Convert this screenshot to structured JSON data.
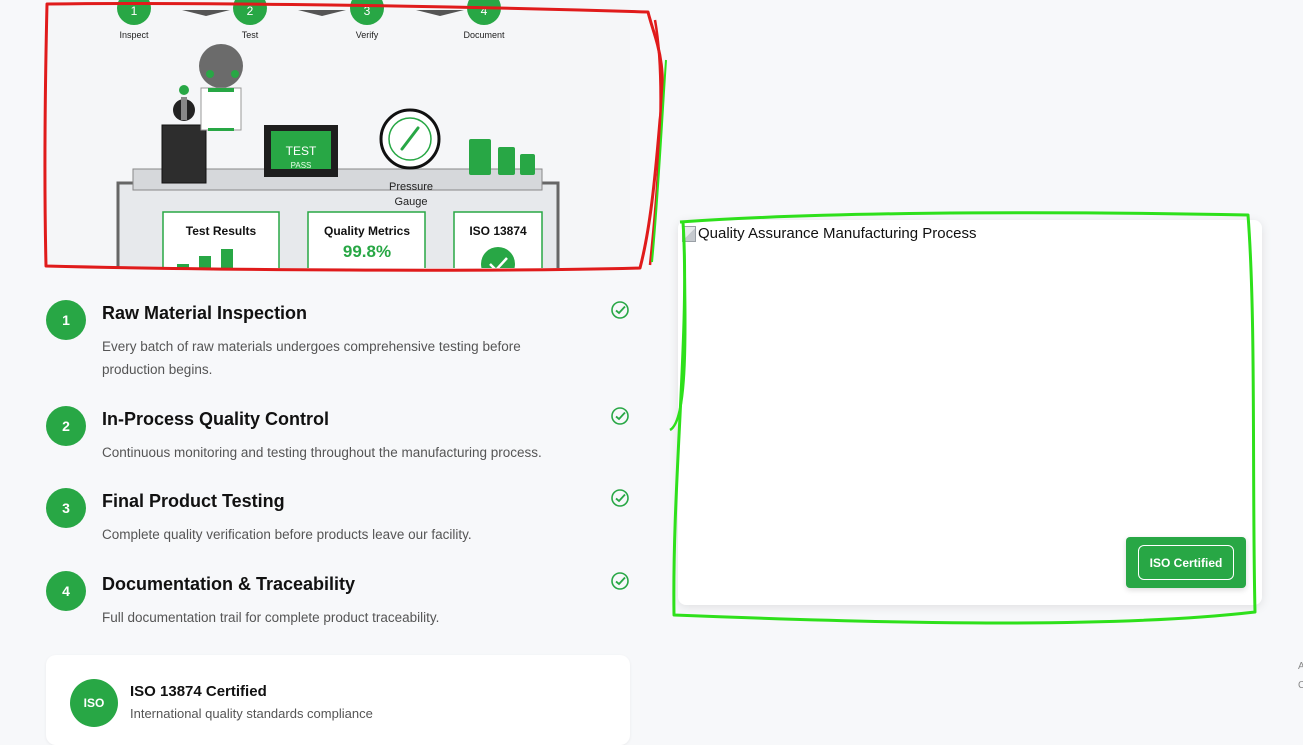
{
  "illustration": {
    "process_steps": [
      {
        "number": "1",
        "label": "Inspect"
      },
      {
        "number": "2",
        "label": "Test"
      },
      {
        "number": "3",
        "label": "Verify"
      },
      {
        "number": "4",
        "label": "Document"
      }
    ],
    "monitor": {
      "title": "TEST",
      "status": "PASS"
    },
    "gauge_label_line1": "Pressure",
    "gauge_label_line2": "Gauge",
    "panels": {
      "test_results": "Test Results",
      "quality_metrics_title": "Quality Metrics",
      "quality_metrics_value": "99.8%",
      "iso_title": "ISO 13874"
    }
  },
  "steps": [
    {
      "number": "1",
      "title": "Raw Material Inspection",
      "description": "Every batch of raw materials undergoes comprehensive testing before production begins."
    },
    {
      "number": "2",
      "title": "In-Process Quality Control",
      "description": "Continuous monitoring and testing throughout the manufacturing process."
    },
    {
      "number": "3",
      "title": "Final Product Testing",
      "description": "Complete quality verification before products leave our facility."
    },
    {
      "number": "4",
      "title": "Documentation & Traceability",
      "description": "Full documentation trail for complete product traceability."
    }
  ],
  "iso_card": {
    "badge": "ISO",
    "title": "ISO 13874 Certified",
    "subtitle": "International quality standards compliance"
  },
  "image_card": {
    "alt_text": "Quality Assurance Manufacturing Process",
    "button_label": "ISO Certified"
  },
  "edge_chars": [
    "A",
    "C"
  ],
  "colors": {
    "accent": "#28a745",
    "annotation_red": "#e01b1b",
    "annotation_green": "#2ee01b"
  }
}
